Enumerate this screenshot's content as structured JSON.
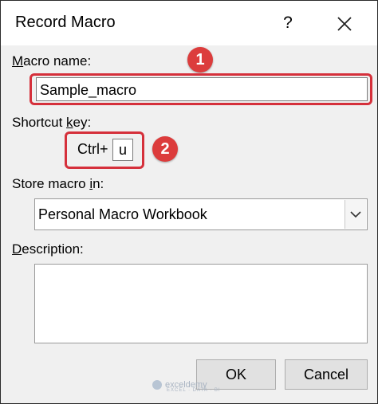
{
  "dialog": {
    "title": "Record Macro",
    "help_label": "?",
    "close_icon": "close-icon"
  },
  "macro_name": {
    "label_underlined": "M",
    "label_rest": "acro name:",
    "value": "Sample_macro",
    "annotation_number": "1"
  },
  "shortcut": {
    "label_prefix": "Shortcut ",
    "label_underlined": "k",
    "label_rest": "ey:",
    "ctrl_label": "Ctrl+",
    "key_value": "u",
    "annotation_number": "2"
  },
  "store": {
    "label_prefix": "Store macro ",
    "label_underlined": "i",
    "label_rest": "n:",
    "selected": "Personal Macro Workbook",
    "dropdown_icon": "chevron-down-icon"
  },
  "description": {
    "label_underlined": "D",
    "label_rest": "escription:",
    "value": ""
  },
  "buttons": {
    "ok": "OK",
    "cancel": "Cancel"
  },
  "watermark": {
    "brand": "exceldemy",
    "tagline": "EXCEL · DATA · BI"
  },
  "colors": {
    "annotation_red": "#d5303b",
    "dialog_bg": "#f0f0f0"
  }
}
